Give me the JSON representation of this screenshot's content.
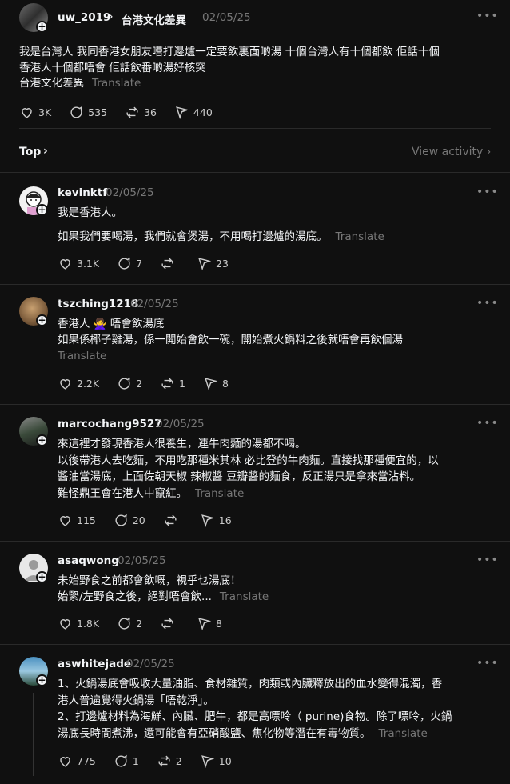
{
  "op": {
    "username": "uw_2019",
    "topic": "台港文化差異",
    "time": "02/05/25",
    "lines": [
      "我是台灣人 我同香港女朋友嘈打邊爐一定要飲裏面啲湯 十個台灣人有十個都飲 佢話十個",
      "香港人十個都唔會 佢話飲番啲湯好核突"
    ],
    "tag": "台港文化差異",
    "translate": "Translate",
    "likes": "3K",
    "replies": "535",
    "reposts": "36",
    "shares": "440"
  },
  "sort": {
    "label": "Top",
    "view_activity": "View activity"
  },
  "comments": [
    {
      "username": "kevinktf",
      "time": "02/05/25",
      "lines": [
        "我是香港人。",
        "",
        "如果我們要喝湯，我們就會煲湯，不用喝打邊爐的湯底。"
      ],
      "translate": "Translate",
      "likes": "3.1K",
      "replies": "7",
      "reposts": "",
      "shares": "23"
    },
    {
      "username": "tszching1218",
      "time": "02/05/25",
      "lines": [
        "香港人 🙅‍♀️ 唔會飲湯底",
        "如果係椰子雞湯，係一開始會飲一碗，開始煮火鍋料之後就唔會再飲個湯"
      ],
      "translate": "Translate",
      "likes": "2.2K",
      "replies": "2",
      "reposts": "1",
      "shares": "8"
    },
    {
      "username": "marcochang9527",
      "time": "02/05/25",
      "lines": [
        "來這裡才發現香港人很養生，連牛肉麵的湯都不喝。",
        "以後帶港人去吃麵，不用吃那種米其林 必比登的牛肉麵。直接找那種便宜的，以",
        "醬油當湯底，上面佐朝天椒 辣椒醬 豆瓣醬的麵食，反正湯只是拿來當沾料。",
        "難怪鼎王會在港人中竄紅。"
      ],
      "translate": "Translate",
      "likes": "115",
      "replies": "20",
      "reposts": "",
      "shares": "16"
    },
    {
      "username": "asaqwong",
      "time": "02/05/25",
      "lines": [
        "未始野食之前都會飲嘅，視乎乜湯底！",
        "始緊/左野食之後，絕對唔會飲..."
      ],
      "translate": "Translate",
      "likes": "1.8K",
      "replies": "2",
      "reposts": "",
      "shares": "8"
    },
    {
      "username": "aswhitejade",
      "time": "02/05/25",
      "lines": [
        "1、火鍋湯底會吸收大量油脂、食材雜質，肉類或內臟釋放出的血水變得混濁，香",
        "港人普遍覺得火鍋湯「唔乾淨」。",
        "2、打邊爐材料為海鮮、內臟、肥牛，都是高嘌呤（ purine)食物。除了嘌呤，火鍋",
        "湯底長時間煮沸，還可能會有亞硝酸鹽、焦化物等潛在有毒物質。"
      ],
      "translate": "Translate",
      "likes": "775",
      "replies": "1",
      "reposts": "2",
      "shares": "10"
    }
  ]
}
